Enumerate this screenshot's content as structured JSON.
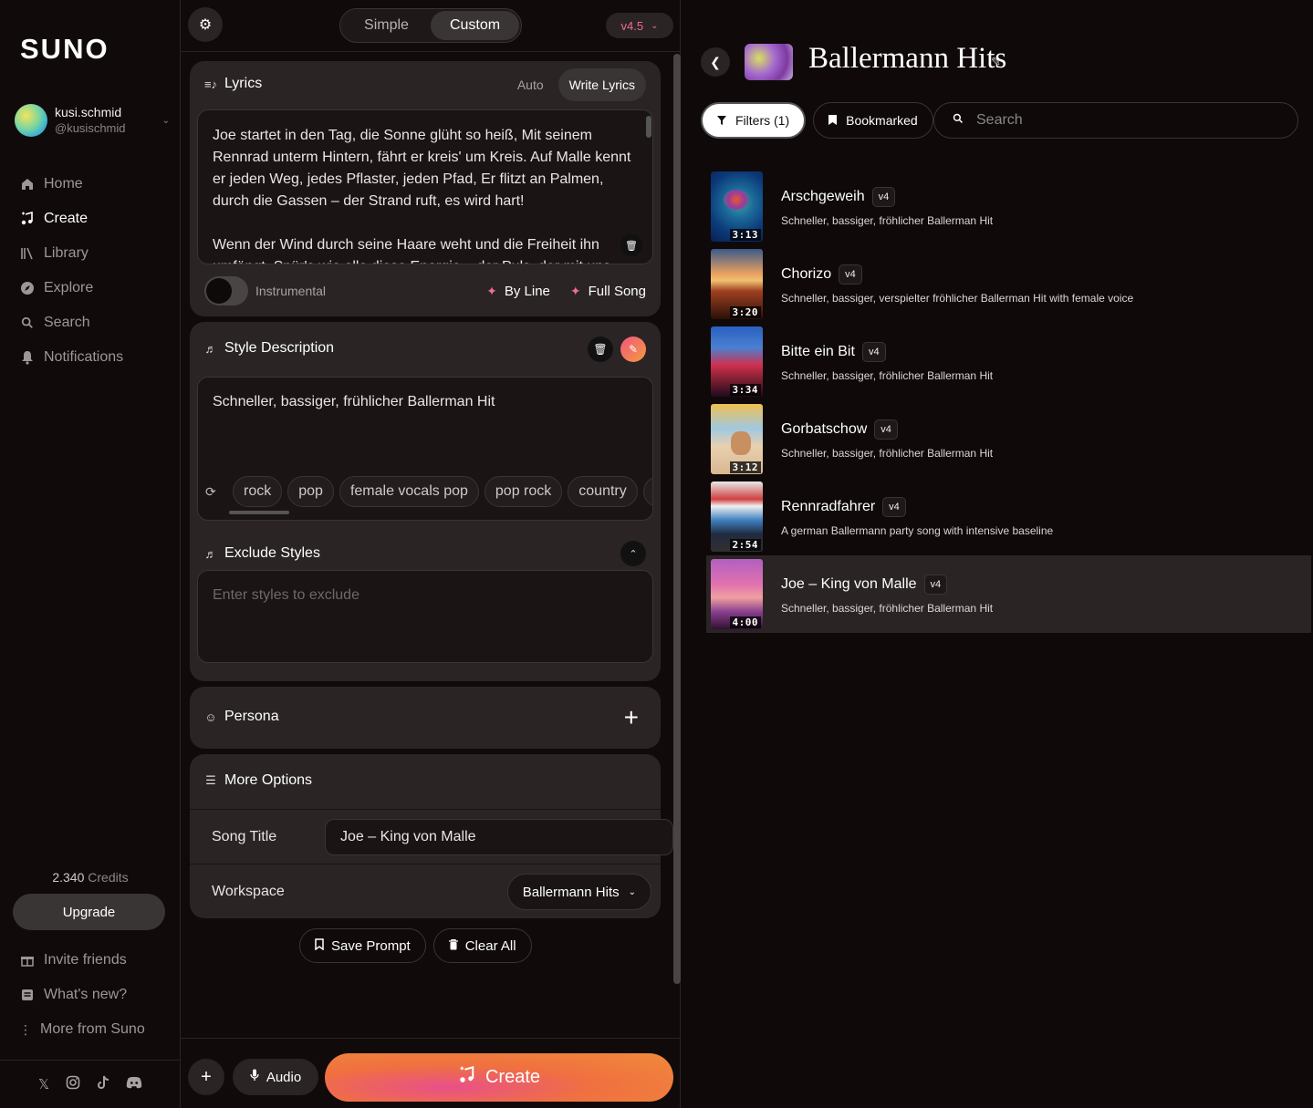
{
  "sidebar": {
    "logo": "SUNO",
    "user": {
      "name": "kusi.schmid",
      "handle": "@kusischmid"
    },
    "nav": [
      {
        "label": "Home",
        "icon": "home-icon"
      },
      {
        "label": "Create",
        "icon": "create-icon"
      },
      {
        "label": "Library",
        "icon": "library-icon"
      },
      {
        "label": "Explore",
        "icon": "explore-icon"
      },
      {
        "label": "Search",
        "icon": "search-icon"
      },
      {
        "label": "Notifications",
        "icon": "bell-icon"
      }
    ],
    "credits_value": "2.340",
    "credits_label": "Credits",
    "upgrade_label": "Upgrade",
    "bottom_nav": [
      {
        "label": "Invite friends",
        "icon": "gift-icon"
      },
      {
        "label": "What's new?",
        "icon": "news-icon"
      },
      {
        "label": "More from Suno",
        "icon": "more-vertical-icon"
      }
    ],
    "socials": [
      "x-icon",
      "instagram-icon",
      "tiktok-icon",
      "discord-icon"
    ]
  },
  "create": {
    "mode_simple": "Simple",
    "mode_custom": "Custom",
    "version": "v4.5",
    "lyrics": {
      "title": "Lyrics",
      "tab_auto": "Auto",
      "tab_write": "Write Lyrics",
      "paragraph1": "Joe startet in den Tag, die Sonne glüht so heiß, Mit seinem Rennrad unterm Hintern, fährt er kreis' um Kreis. Auf Malle kennt er jeden Weg, jedes Pflaster, jeden Pfad, Er flitzt an Palmen, durch die Gassen – der Strand ruft, es wird hart!",
      "paragraph2": "Wenn der Wind durch seine Haare weht und die Freiheit ihn umfängt, Spür's wie alle diese Energie – der Puls, der mit uns tanzt!",
      "instrumental_label": "Instrumental",
      "by_line": "By Line",
      "full_song": "Full Song"
    },
    "style": {
      "title": "Style Description",
      "value": "Schneller, bassiger, frühlicher Ballerman Hit",
      "tags": [
        "rock",
        "pop",
        "female vocals pop",
        "pop rock",
        "country",
        "anir"
      ]
    },
    "exclude": {
      "title": "Exclude Styles",
      "placeholder": "Enter styles to exclude"
    },
    "persona": {
      "title": "Persona"
    },
    "options": {
      "title": "More Options",
      "song_title_label": "Song Title",
      "song_title_value": "Joe – King von Malle",
      "workspace_label": "Workspace",
      "workspace_value": "Ballermann Hits"
    },
    "save_prompt": "Save Prompt",
    "clear_all": "Clear All",
    "audio_label": "Audio",
    "create_label": "Create"
  },
  "workspace": {
    "title": "Ballermann Hits",
    "filters_label": "Filters (1)",
    "bookmarked_label": "Bookmarked",
    "search_placeholder": "Search",
    "songs": [
      {
        "title": "Arschgeweih",
        "version": "v4",
        "desc": "Schneller, bassiger, fröhlicher Ballerman Hit",
        "duration": "3:13",
        "thumb": "turtle"
      },
      {
        "title": "Chorizo",
        "version": "v4",
        "desc": "Schneller, bassiger, verspielter fröhlicher Ballerman Hit with female voice",
        "duration": "3:20",
        "thumb": "sunset"
      },
      {
        "title": "Bitte ein Bit",
        "version": "v4",
        "desc": "Schneller, bassiger, fröhlicher Ballerman Hit",
        "duration": "3:34",
        "thumb": "palms"
      },
      {
        "title": "Gorbatschow",
        "version": "v4",
        "desc": "Schneller, bassiger, fröhlicher Ballerman Hit",
        "duration": "3:12",
        "thumb": "cat"
      },
      {
        "title": "Rennradfahrer",
        "version": "v4",
        "desc": "A german Ballermann party song with intensive baseline",
        "duration": "2:54",
        "thumb": "bikes"
      },
      {
        "title": "Joe – King von Malle",
        "version": "v4",
        "desc": "Schneller, bassiger, fröhlicher Ballerman Hit",
        "duration": "4:00",
        "thumb": "beach-bike"
      }
    ]
  }
}
